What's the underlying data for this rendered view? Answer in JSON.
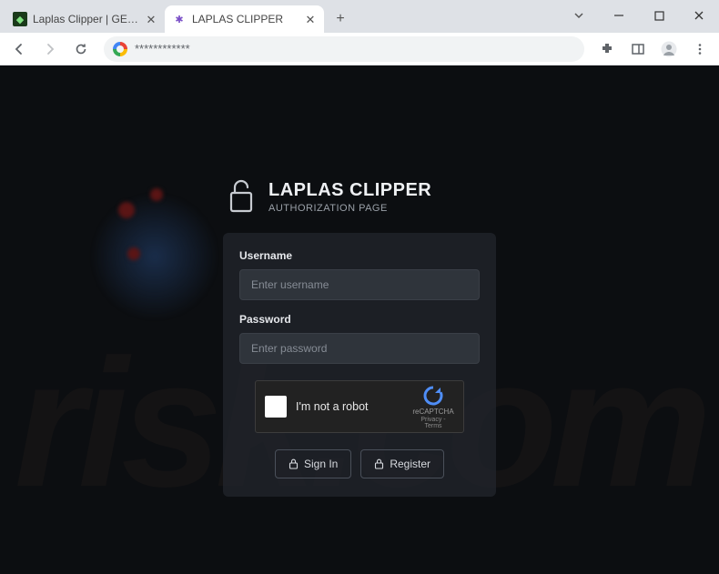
{
  "browser": {
    "tabs": [
      {
        "title": "Laplas Clipper | GENERATION OF",
        "active": false
      },
      {
        "title": "LAPLAS CLIPPER",
        "active": true
      }
    ],
    "omnibox_value": "************"
  },
  "page": {
    "brand_title": "LAPLAS CLIPPER",
    "brand_subtitle": "AUTHORIZATION PAGE",
    "username_label": "Username",
    "username_placeholder": "Enter username",
    "username_value": "",
    "password_label": "Password",
    "password_placeholder": "Enter password",
    "password_value": "",
    "recaptcha_text": "I'm not a robot",
    "recaptcha_brand": "reCAPTCHA",
    "recaptcha_legal": "Privacy - Terms",
    "signin_label": "Sign In",
    "register_label": "Register",
    "watermark_text": "risk.com"
  },
  "colors": {
    "page_bg": "#0c0e11",
    "panel_bg": "rgba(32,36,42,0.80)",
    "input_bg": "#2f343b",
    "accent": "#4a505a"
  }
}
